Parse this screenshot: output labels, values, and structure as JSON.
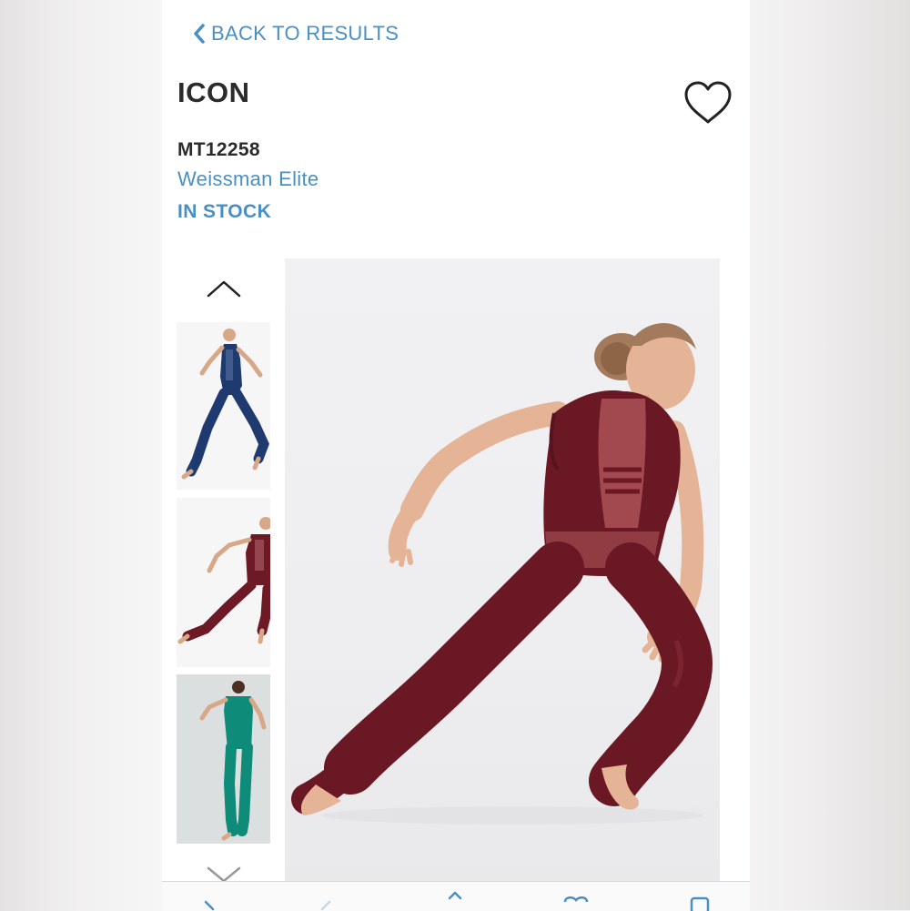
{
  "nav": {
    "back_label": "BACK TO RESULTS",
    "back_icon": "chevron-left-icon"
  },
  "product": {
    "name": "ICON",
    "sku": "MT12258",
    "collection": "Weissman Elite",
    "availability": "IN STOCK",
    "favorite_icon": "heart-outline-icon"
  },
  "gallery": {
    "prev_icon": "chevron-up-icon",
    "next_icon": "chevron-down-icon",
    "thumbnails": [
      {
        "color_hex": "#1f3a6e",
        "selected": false
      },
      {
        "color_hex": "#6e1a26",
        "selected": false
      },
      {
        "color_hex": "#0f8b7a",
        "selected": false
      }
    ],
    "main_image_color_hex": "#6a1824"
  },
  "colors": {
    "accent": "#4a8fc4",
    "text": "#2b2b2b"
  }
}
